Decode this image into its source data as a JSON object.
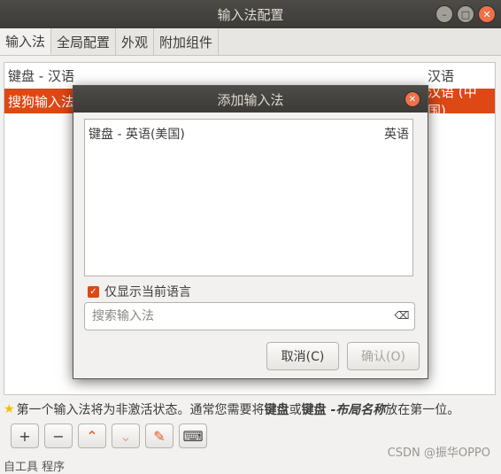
{
  "window": {
    "title": "输入法配置"
  },
  "tabs": [
    {
      "label": "输入法"
    },
    {
      "label": "全局配置"
    },
    {
      "label": "外观"
    },
    {
      "label": "附加组件"
    }
  ],
  "im_list": {
    "header": {
      "name": "键盘 - 汉语",
      "lang": "汉语"
    },
    "selected_row": {
      "name": "搜狗输入法",
      "lang": "汉语 (中国)"
    }
  },
  "dialog": {
    "title": "添加输入法",
    "items": [
      {
        "name": "键盘 - 英语(美国)",
        "lang": "英语"
      }
    ],
    "checkbox_label": "仅显示当前语言",
    "search_placeholder": "搜索输入法",
    "cancel_label": "取消(C)",
    "ok_label": "确认(O)"
  },
  "hint": {
    "text1": "第一个输入法将为非激活状态。通常您需要将",
    "bold1": "键盘",
    "text2": "或",
    "bold2": "键盘 - ",
    "italic": "布局名称",
    "text3": "放在第一位。"
  },
  "toolbar": {
    "add": "+",
    "remove": "−",
    "up": "⌃",
    "down": "⌄",
    "keyboard": "⌨"
  },
  "bottom_text": "自工具  程序",
  "watermark": "CSDN @振华OPPO",
  "colors": {
    "accent": "#dd4814"
  }
}
